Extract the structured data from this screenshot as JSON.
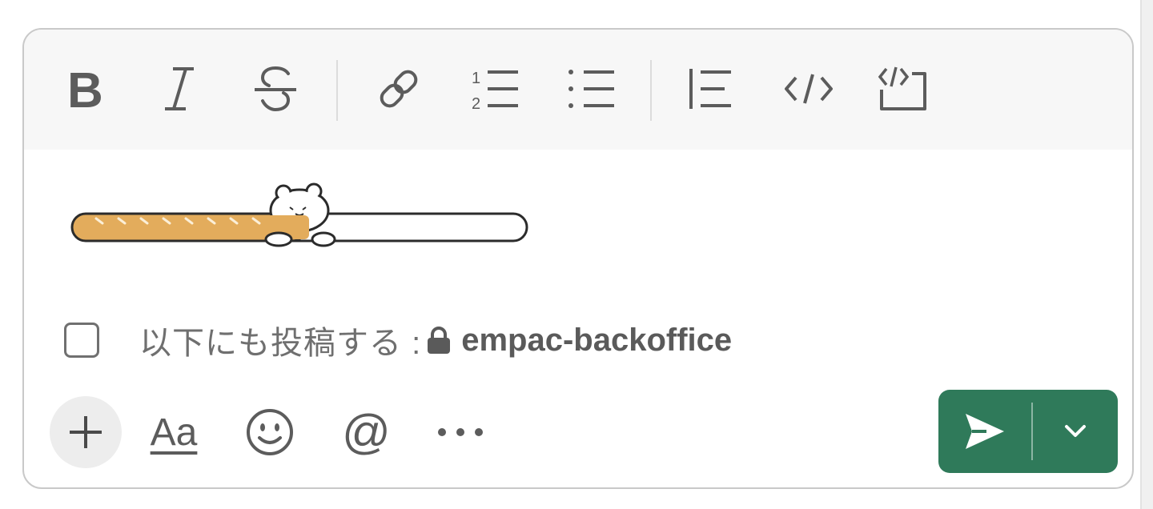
{
  "toolbar": {
    "items": [
      "bold",
      "italic",
      "strikethrough",
      "link",
      "ordered-list",
      "bulleted-list",
      "blockquote",
      "code",
      "code-block"
    ]
  },
  "message": {
    "sticker": "bread-bear-sticker"
  },
  "crosspost": {
    "label": "以下にも投稿する :",
    "channel": "empac-backoffice",
    "checked": false
  },
  "bottom_bar": {
    "format_label": "Aa"
  },
  "colors": {
    "send_button": "#2f7a5a",
    "toolbar_bg": "#f7f7f7",
    "icon": "#5c5c5c"
  }
}
